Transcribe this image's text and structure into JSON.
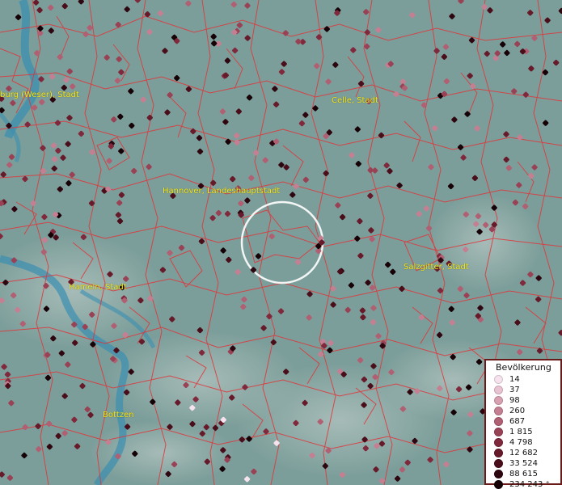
{
  "map": {
    "colors": {
      "land": "#7c9e9a",
      "river": "#3b8fb0",
      "borders": "#e0353a",
      "label": "#f2ea1b",
      "selection": "#ffffff"
    },
    "labels": [
      {
        "id": "hamburg-wesen",
        "text": "burg (Weser), Stadt"
      },
      {
        "id": "celle",
        "text": "Celle, Stadt"
      },
      {
        "id": "hannover",
        "text": "Hannover, Landeshauptstadt"
      },
      {
        "id": "salzgitter",
        "text": "Salzgitter, Stadt"
      },
      {
        "id": "hameln",
        "text": "Hameln, Stadt"
      },
      {
        "id": "bottzen",
        "text": "Bottzen"
      }
    ]
  },
  "legend": {
    "title": "Bevölkerung",
    "items": [
      {
        "value": "14",
        "color": "#f6e3ee"
      },
      {
        "value": "37",
        "color": "#e9c3d2"
      },
      {
        "value": "98",
        "color": "#d8a0b0"
      },
      {
        "value": "260",
        "color": "#c48092"
      },
      {
        "value": "687",
        "color": "#b06072"
      },
      {
        "value": "1 815",
        "color": "#994255"
      },
      {
        "value": "4 798",
        "color": "#80293c"
      },
      {
        "value": "12 682",
        "color": "#661a2a"
      },
      {
        "value": "33 524",
        "color": "#4a0e1b"
      },
      {
        "value": "88 615",
        "color": "#2e0610"
      },
      {
        "value": "234 243 ⁺",
        "color": "#150106"
      }
    ]
  }
}
